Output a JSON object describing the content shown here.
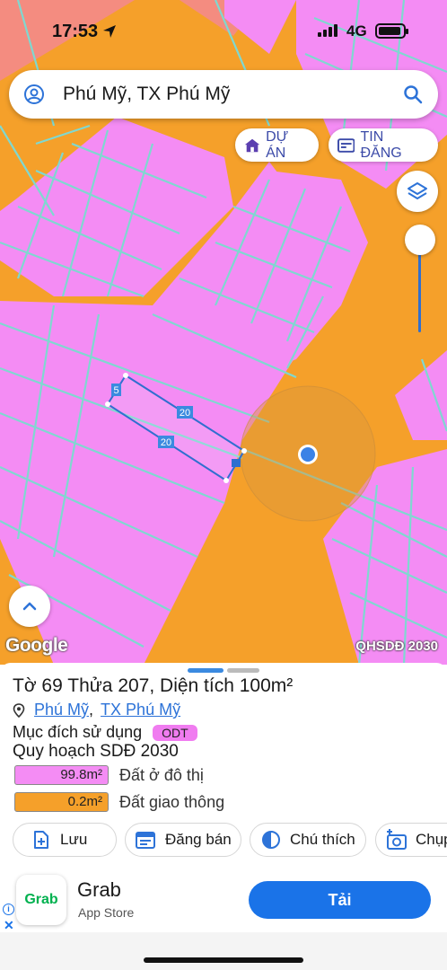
{
  "status_bar": {
    "time": "17:53",
    "network": "4G"
  },
  "search": {
    "query": "Phú Mỹ, TX Phú Mỹ"
  },
  "chips": {
    "projects": "DỰ ÁN",
    "listings": "TIN ĐĂNG"
  },
  "map": {
    "google_logo": "Google",
    "source": "QHSDĐ 2030",
    "dimensions": {
      "short_side": "5",
      "top_side": "20",
      "bottom_side": "20"
    },
    "colors": {
      "residential": "#f48cf4",
      "traffic": "#f5a02a",
      "parcel_lines": "#7fd8d0",
      "selection": "#2f6fcf"
    }
  },
  "parcel": {
    "title": "Tờ 69 Thửa 207, Diện tích 100m²",
    "ward": "Phú Mỹ",
    "town": "TX Phú Mỹ",
    "purpose_label": "Mục đích sử dụng",
    "purpose_code": "ODT",
    "plan_title": "Quy hoạch SDĐ 2030",
    "land_uses": [
      {
        "area": "99.8m²",
        "label": "Đất ở đô thị",
        "color": "#f48cf4"
      },
      {
        "area": "0.2m²",
        "label": "Đất giao thông",
        "color": "#f5a02a"
      }
    ]
  },
  "actions": {
    "save": "Lưu",
    "post_sale": "Đăng bán",
    "legend": "Chú thích",
    "capture": "Chụp"
  },
  "ad": {
    "logo_text": "Grab",
    "title": "Grab",
    "subtitle": "App Store",
    "cta": "Tải"
  }
}
